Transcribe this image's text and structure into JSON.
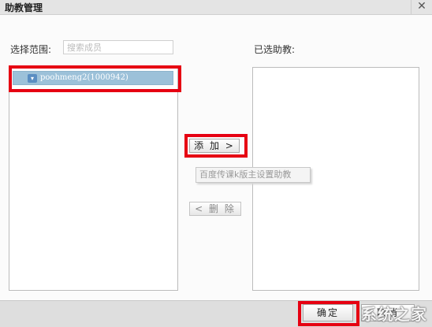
{
  "window": {
    "title": "助教管理",
    "close_glyph": "✕"
  },
  "left": {
    "scope_label": "选择范围:",
    "search_placeholder": "搜索成员",
    "members": [
      {
        "name": "poohmeng2(1000942)",
        "icon": "user-icon"
      }
    ]
  },
  "right": {
    "selected_label": "已选助教:"
  },
  "actions": {
    "add_label": "添 加 >",
    "delete_label": "< 删 除",
    "tooltip": "百度传课k版主设置助教"
  },
  "footer": {
    "confirm_label": "确定",
    "cancel_label": "取消"
  },
  "annotation_color": "#e60012",
  "watermark": {
    "text": "系统之家"
  }
}
